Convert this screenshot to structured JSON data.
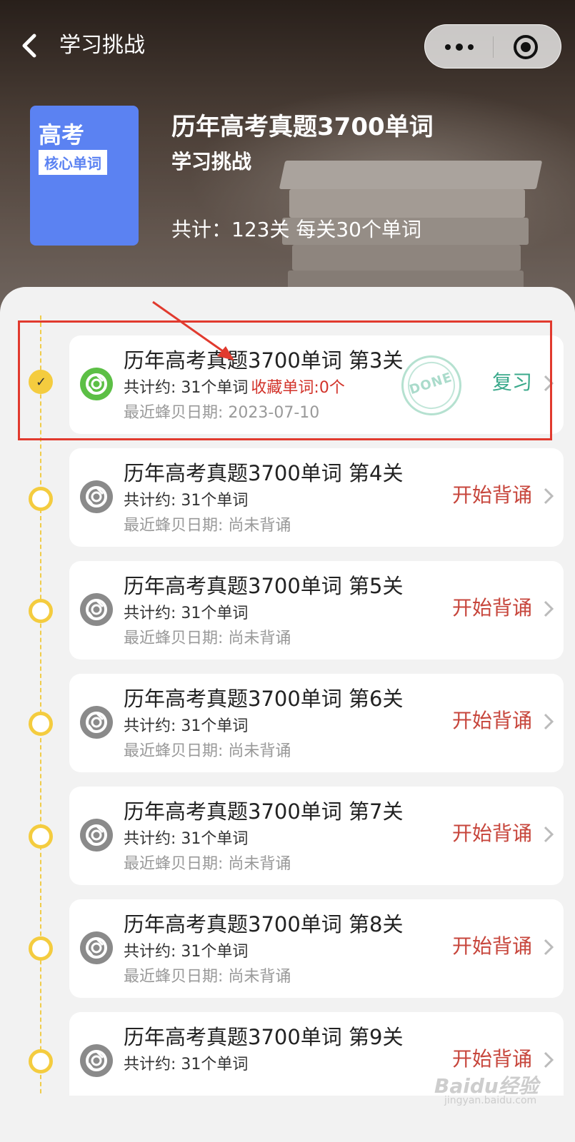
{
  "topbar": {
    "title": "学习挑战"
  },
  "book": {
    "cover_title": "高考",
    "cover_tag": "核心单词",
    "name": "历年高考真题3700单词",
    "subtitle": "学习挑战",
    "stats": "共计：123关 每关30个单词"
  },
  "stamp": {
    "text": "DONE"
  },
  "levels": [
    {
      "title": "历年高考真题3700单词 第3关",
      "count": "共计约: 31个单词",
      "favorites": "收藏单词:0个",
      "date": "最近蜂贝日期: 2023-07-10",
      "action": "复习",
      "status": "done"
    },
    {
      "title": "历年高考真题3700单词 第4关",
      "count": "共计约: 31个单词",
      "date": "最近蜂贝日期: 尚未背诵",
      "action": "开始背诵",
      "status": "todo"
    },
    {
      "title": "历年高考真题3700单词 第5关",
      "count": "共计约: 31个单词",
      "date": "最近蜂贝日期: 尚未背诵",
      "action": "开始背诵",
      "status": "todo"
    },
    {
      "title": "历年高考真题3700单词 第6关",
      "count": "共计约: 31个单词",
      "date": "最近蜂贝日期: 尚未背诵",
      "action": "开始背诵",
      "status": "todo"
    },
    {
      "title": "历年高考真题3700单词 第7关",
      "count": "共计约: 31个单词",
      "date": "最近蜂贝日期: 尚未背诵",
      "action": "开始背诵",
      "status": "todo"
    },
    {
      "title": "历年高考真题3700单词 第8关",
      "count": "共计约: 31个单词",
      "date": "最近蜂贝日期: 尚未背诵",
      "action": "开始背诵",
      "status": "todo"
    },
    {
      "title": "历年高考真题3700单词 第9关",
      "count": "共计约: 31个单词",
      "action": "开始背诵",
      "status": "todo"
    }
  ],
  "watermark": {
    "text": "Baidu经验",
    "sub": "jingyan.baidu.com"
  },
  "colors": {
    "accent_yellow": "#f4cc3f",
    "start_red": "#c7463c",
    "review_green": "#3aa98b",
    "cover_blue": "#5b82f2",
    "highlight_red": "#e13a2e"
  }
}
